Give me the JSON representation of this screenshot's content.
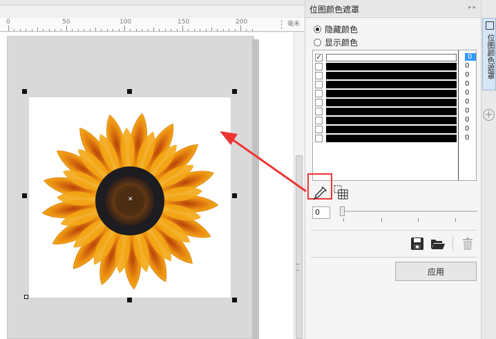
{
  "ruler": {
    "labels": [
      "0",
      "50",
      "100",
      "150",
      "200"
    ],
    "unit": "毫米"
  },
  "panel": {
    "title": "位图颜色遮罩",
    "hide_color_label": "隐藏颜色",
    "show_color_label": "显示颜色",
    "selected_mode": "hide",
    "color_rows": [
      {
        "checked": true,
        "color": "#ffffff",
        "value": "0",
        "selected": true
      },
      {
        "checked": false,
        "color": "#000000",
        "value": "0",
        "selected": false
      },
      {
        "checked": false,
        "color": "#000000",
        "value": "0",
        "selected": false
      },
      {
        "checked": false,
        "color": "#000000",
        "value": "0",
        "selected": false
      },
      {
        "checked": false,
        "color": "#000000",
        "value": "0",
        "selected": false
      },
      {
        "checked": false,
        "color": "#000000",
        "value": "0",
        "selected": false
      },
      {
        "checked": false,
        "color": "#000000",
        "value": "0",
        "selected": false
      },
      {
        "checked": false,
        "color": "#000000",
        "value": "0",
        "selected": false
      },
      {
        "checked": false,
        "color": "#000000",
        "value": "0",
        "selected": false
      },
      {
        "checked": false,
        "color": "#000000",
        "value": "0",
        "selected": false
      }
    ],
    "tolerance_value": "0",
    "apply_label": "应用"
  },
  "side_tab": {
    "label": "位图颜色遮罩"
  },
  "colors": {
    "accent": "#3399ff",
    "highlight_red": "#ee3333"
  }
}
